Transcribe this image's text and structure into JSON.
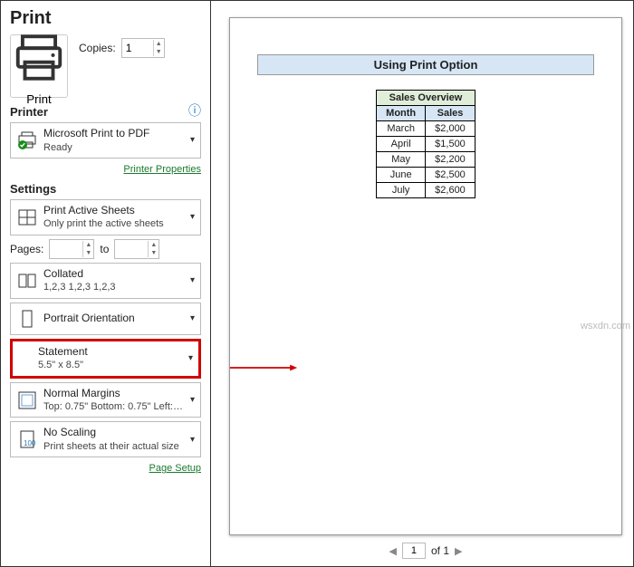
{
  "header": {
    "title": "Print"
  },
  "printBtn": {
    "label": "Print"
  },
  "copies": {
    "label": "Copies:",
    "value": "1"
  },
  "printerSection": {
    "heading": "Printer"
  },
  "printer": {
    "name": "Microsoft Print to PDF",
    "status": "Ready",
    "propsLink": "Printer Properties"
  },
  "settingsSection": {
    "heading": "Settings"
  },
  "printWhat": {
    "main": "Print Active Sheets",
    "sub": "Only print the active sheets"
  },
  "pages": {
    "label": "Pages:",
    "to": "to",
    "from": "",
    "toVal": ""
  },
  "collate": {
    "main": "Collated",
    "sub": "1,2,3    1,2,3    1,2,3"
  },
  "orient": {
    "main": "Portrait Orientation"
  },
  "paper": {
    "main": "Statement",
    "sub": "5.5\" x 8.5\""
  },
  "margins": {
    "main": "Normal Margins",
    "sub": "Top: 0.75\" Bottom: 0.75\" Left:…"
  },
  "scaling": {
    "main": "No Scaling",
    "sub": "Print sheets at their actual size"
  },
  "pageSetupLink": "Page Setup",
  "preview": {
    "docTitle": "Using Print Option",
    "tableTitle": "Sales Overview",
    "col1": "Month",
    "col2": "Sales",
    "rows": [
      {
        "m": "March",
        "v": "$2,000"
      },
      {
        "m": "April",
        "v": "$1,500"
      },
      {
        "m": "May",
        "v": "$2,200"
      },
      {
        "m": "June",
        "v": "$2,500"
      },
      {
        "m": "July",
        "v": "$2,600"
      }
    ]
  },
  "pager": {
    "current": "1",
    "of": "of 1"
  },
  "watermark": "wsxdn.com",
  "chart_data": {
    "type": "table",
    "title": "Sales Overview",
    "columns": [
      "Month",
      "Sales"
    ],
    "rows": [
      [
        "March",
        2000
      ],
      [
        "April",
        1500
      ],
      [
        "May",
        2200
      ],
      [
        "June",
        2500
      ],
      [
        "July",
        2600
      ]
    ]
  }
}
